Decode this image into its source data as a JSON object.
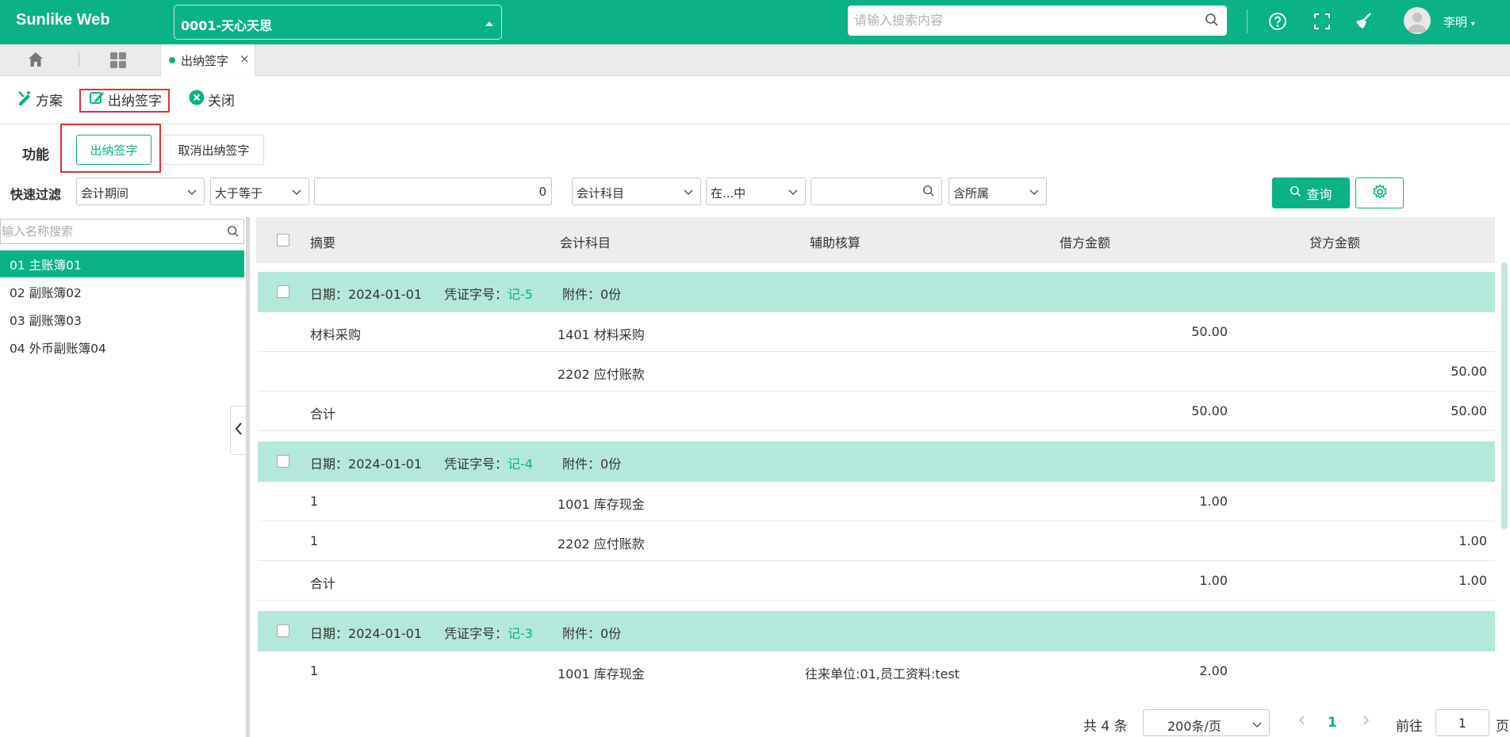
{
  "app": {
    "brand": "Sunlike Web",
    "company": "0001-天心天思",
    "search_placeholder": "请输入搜索内容",
    "user": "李明"
  },
  "tabs": [
    {
      "label": "出纳签字",
      "close": "×"
    }
  ],
  "toolbar": {
    "scheme": "方案",
    "cashier_sign": "出纳签字",
    "close": "关闭"
  },
  "functions": {
    "label": "功能",
    "sign": "出纳签字",
    "cancel_sign": "取消出纳签字"
  },
  "filter": {
    "label": "快速过滤",
    "field1": "会计期间",
    "op1": "大于等于",
    "value1": "0",
    "field2": "会计科目",
    "op2": "在...中",
    "value2": "",
    "scope": "含所属",
    "query": "查询"
  },
  "books": {
    "search_placeholder": "输入名称搜索",
    "items": [
      "01 主账簿01",
      "02 副账簿02",
      "03 副账簿03",
      "04 外币副账簿04"
    ],
    "selected": 0
  },
  "grid": {
    "columns": [
      "摘要",
      "会计科目",
      "辅助核算",
      "借方金额",
      "贷方金额"
    ],
    "date_label": "日期：",
    "voucher_label": "凭证字号：",
    "attach_label": "附件：",
    "vouchers": [
      {
        "date": "2024-01-01",
        "no": "记-5",
        "attach": "0份",
        "lines": [
          {
            "summary": "材料采购",
            "account": "1401 材料采购",
            "aux": "",
            "debit": "50.00",
            "credit": ""
          },
          {
            "summary": "",
            "account": "2202 应付账款",
            "aux": "",
            "debit": "",
            "credit": "50.00"
          },
          {
            "summary": "合计",
            "account": "",
            "aux": "",
            "debit": "50.00",
            "credit": "50.00"
          }
        ]
      },
      {
        "date": "2024-01-01",
        "no": "记-4",
        "attach": "0份",
        "lines": [
          {
            "summary": "1",
            "account": "1001 库存现金",
            "aux": "",
            "debit": "1.00",
            "credit": ""
          },
          {
            "summary": "1",
            "account": "2202 应付账款",
            "aux": "",
            "debit": "",
            "credit": "1.00"
          },
          {
            "summary": "合计",
            "account": "",
            "aux": "",
            "debit": "1.00",
            "credit": "1.00"
          }
        ]
      },
      {
        "date": "2024-01-01",
        "no": "记-3",
        "attach": "0份",
        "lines": [
          {
            "summary": "1",
            "account": "1001 库存现金",
            "aux": "往来单位:01,员工资料:test",
            "debit": "2.00",
            "credit": ""
          }
        ]
      }
    ]
  },
  "pager": {
    "total": "共 4 条",
    "page_size": "200条/页",
    "current": "1",
    "goto": "前往",
    "goto_value": "1",
    "page_unit": "页"
  },
  "colors": {
    "primary": "#0bb286",
    "group_bg": "#b4e8da",
    "highlight": "#e03131"
  },
  "icons": [
    "search-icon",
    "help-icon",
    "fullscreen-icon",
    "clean-icon",
    "user-icon",
    "home-icon",
    "apps-icon",
    "scheme-icon",
    "sign-icon",
    "close-circle-icon",
    "gear-icon",
    "chevron-left-icon"
  ]
}
